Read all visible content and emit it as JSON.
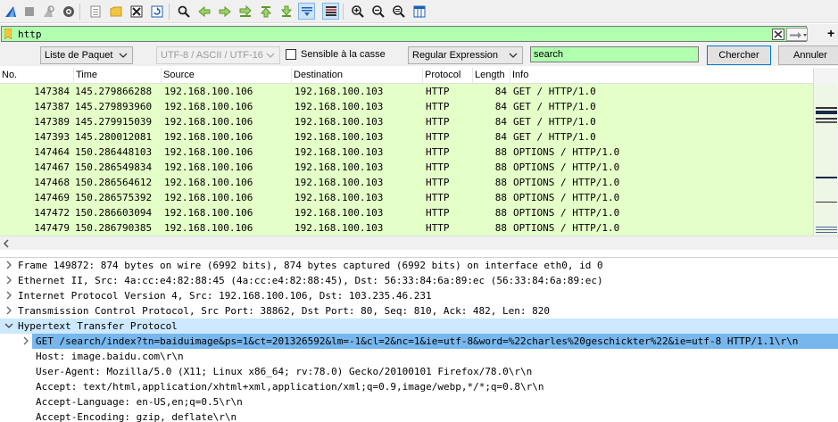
{
  "toolbar": {
    "icons": [
      "shark-fin-icon",
      "stop-icon",
      "restart-icon",
      "gear-icon",
      "open-file-icon",
      "save-file-icon",
      "close-file-icon",
      "reload-icon",
      "find-icon",
      "go-back-icon",
      "go-forward-icon",
      "go-to-packet-icon",
      "go-first-icon",
      "go-last-icon",
      "autoscroll-icon",
      "colorize-icon",
      "zoom-in-icon",
      "zoom-out-icon",
      "zoom-reset-icon",
      "resize-columns-icon"
    ]
  },
  "display_filter": {
    "value": "http",
    "bg_color": "#afffaf"
  },
  "find_bar": {
    "search_in": "Liste de Paquet",
    "encoding": "UTF-8 / ASCII / UTF-16",
    "case_sensitive_label": "Sensible à la casse",
    "case_sensitive_checked": false,
    "search_type": "Regular Expression",
    "search_value": "search",
    "find_label": "Chercher",
    "cancel_label": "Annuler"
  },
  "packet_list": {
    "columns": [
      "No.",
      "Time",
      "Source",
      "Destination",
      "Protocol",
      "Length",
      "Info"
    ],
    "row_color": "#e4ffc7",
    "rows": [
      {
        "no": "147384",
        "time": "145.279866288",
        "src": "192.168.100.106",
        "dst": "192.168.100.103",
        "proto": "HTTP",
        "len": "84",
        "info": "GET / HTTP/1.0"
      },
      {
        "no": "147387",
        "time": "145.279893960",
        "src": "192.168.100.106",
        "dst": "192.168.100.103",
        "proto": "HTTP",
        "len": "84",
        "info": "GET / HTTP/1.0"
      },
      {
        "no": "147389",
        "time": "145.279915039",
        "src": "192.168.100.106",
        "dst": "192.168.100.103",
        "proto": "HTTP",
        "len": "84",
        "info": "GET / HTTP/1.0"
      },
      {
        "no": "147393",
        "time": "145.280012081",
        "src": "192.168.100.106",
        "dst": "192.168.100.103",
        "proto": "HTTP",
        "len": "84",
        "info": "GET / HTTP/1.0"
      },
      {
        "no": "147464",
        "time": "150.286448103",
        "src": "192.168.100.106",
        "dst": "192.168.100.103",
        "proto": "HTTP",
        "len": "88",
        "info": "OPTIONS / HTTP/1.0"
      },
      {
        "no": "147467",
        "time": "150.286549834",
        "src": "192.168.100.106",
        "dst": "192.168.100.103",
        "proto": "HTTP",
        "len": "88",
        "info": "OPTIONS / HTTP/1.0"
      },
      {
        "no": "147468",
        "time": "150.286564612",
        "src": "192.168.100.106",
        "dst": "192.168.100.103",
        "proto": "HTTP",
        "len": "88",
        "info": "OPTIONS / HTTP/1.0"
      },
      {
        "no": "147469",
        "time": "150.286575392",
        "src": "192.168.100.106",
        "dst": "192.168.100.103",
        "proto": "HTTP",
        "len": "88",
        "info": "OPTIONS / HTTP/1.0"
      },
      {
        "no": "147472",
        "time": "150.286603094",
        "src": "192.168.100.106",
        "dst": "192.168.100.103",
        "proto": "HTTP",
        "len": "88",
        "info": "OPTIONS / HTTP/1.0"
      },
      {
        "no": "147479",
        "time": "150.286790385",
        "src": "192.168.100.106",
        "dst": "192.168.100.103",
        "proto": "HTTP",
        "len": "88",
        "info": "OPTIONS / HTTP/1.0"
      }
    ]
  },
  "details": {
    "items": [
      {
        "text": "Frame 149872: 874 bytes on wire (6992 bits), 874 bytes captured (6992 bits) on interface eth0, id 0",
        "toggle": "collapsed",
        "level": 0
      },
      {
        "text": "Ethernet II, Src: 4a:cc:e4:82:88:45 (4a:cc:e4:82:88:45), Dst: 56:33:84:6a:89:ec (56:33:84:6a:89:ec)",
        "toggle": "collapsed",
        "level": 0
      },
      {
        "text": "Internet Protocol Version 4, Src: 192.168.100.106, Dst: 103.235.46.231",
        "toggle": "collapsed",
        "level": 0
      },
      {
        "text": "Transmission Control Protocol, Src Port: 38862, Dst Port: 80, Seq: 810, Ack: 482, Len: 820",
        "toggle": "collapsed",
        "level": 0
      },
      {
        "text": "Hypertext Transfer Protocol",
        "toggle": "expanded",
        "level": 0,
        "state": "highlighted"
      },
      {
        "text": "GET /search/index?tn=baiduimage&ps=1&ct=201326592&lm=-1&cl=2&nc=1&ie=utf-8&word=%22charles%20geschickter%22&ie=utf-8 HTTP/1.1\\r\\n",
        "toggle": "collapsed",
        "level": 1,
        "state": "selected"
      },
      {
        "text": "Host: image.baidu.com\\r\\n",
        "toggle": "none",
        "level": 1
      },
      {
        "text": "User-Agent: Mozilla/5.0 (X11; Linux x86_64; rv:78.0) Gecko/20100101 Firefox/78.0\\r\\n",
        "toggle": "none",
        "level": 1
      },
      {
        "text": "Accept: text/html,application/xhtml+xml,application/xml;q=0.9,image/webp,*/*;q=0.8\\r\\n",
        "toggle": "none",
        "level": 1
      },
      {
        "text": "Accept-Language: en-US,en;q=0.5\\r\\n",
        "toggle": "none",
        "level": 1
      },
      {
        "text": "Accept-Encoding: gzip, deflate\\r\\n",
        "toggle": "none",
        "level": 1
      }
    ]
  }
}
